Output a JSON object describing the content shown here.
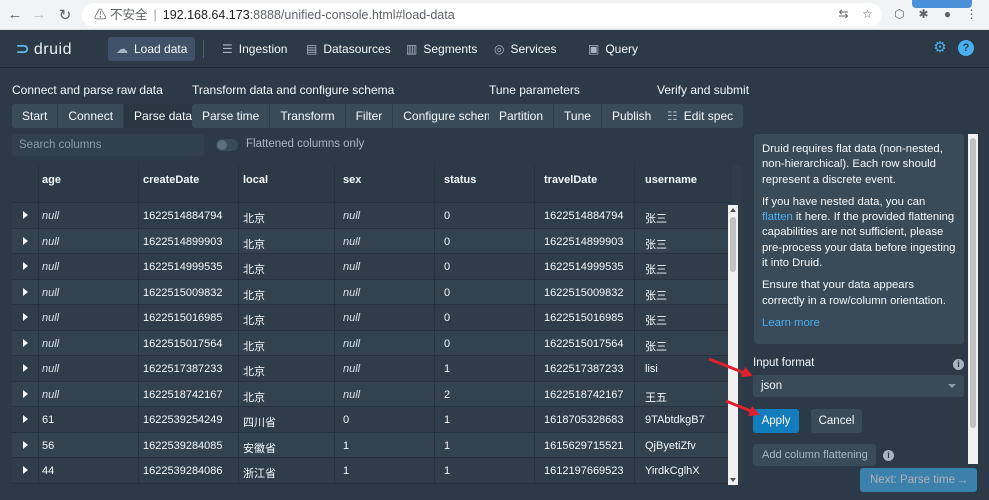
{
  "browser": {
    "back_icon": "arrow-left-icon",
    "forward_icon": "arrow-right-icon",
    "reload_icon": "reload-icon",
    "security_label": "不安全",
    "url_host": "192.168.64.173",
    "url_rest": ":8888/unified-console.html#load-data"
  },
  "nav": {
    "logo": "druid",
    "items": [
      {
        "label": "Load data",
        "icon": "cloud-upload-icon"
      },
      {
        "label": "Ingestion",
        "icon": "gantt-chart-icon"
      },
      {
        "label": "Datasources",
        "icon": "multi-select-icon"
      },
      {
        "label": "Segments",
        "icon": "stacked-chart-icon"
      },
      {
        "label": "Services",
        "icon": "database-icon"
      },
      {
        "label": "Query",
        "icon": "application-icon"
      }
    ]
  },
  "steps": {
    "groups": [
      {
        "title": "Connect and parse raw data",
        "buttons": [
          "Start",
          "Connect",
          "Parse data"
        ]
      },
      {
        "title": "Transform data and configure schema",
        "buttons": [
          "Parse time",
          "Transform",
          "Filter",
          "Configure schema"
        ]
      },
      {
        "title": "Tune parameters",
        "buttons": [
          "Partition",
          "Tune",
          "Publish"
        ]
      },
      {
        "title": "Verify and submit",
        "buttons": [
          "Edit spec"
        ]
      }
    ],
    "active": "Parse data"
  },
  "search": {
    "placeholder": "Search columns"
  },
  "flatten_toggle": {
    "label": "Flattened columns only",
    "on": false
  },
  "table": {
    "columns": [
      "age",
      "createDate",
      "local",
      "sex",
      "status",
      "travelDate",
      "username"
    ],
    "rows": [
      [
        "null",
        "1622514884794",
        "北京",
        "null",
        "0",
        "1622514884794",
        "张三"
      ],
      [
        "null",
        "1622514899903",
        "北京",
        "null",
        "0",
        "1622514899903",
        "张三"
      ],
      [
        "null",
        "1622514999535",
        "北京",
        "null",
        "0",
        "1622514999535",
        "张三"
      ],
      [
        "null",
        "1622515009832",
        "北京",
        "null",
        "0",
        "1622515009832",
        "张三"
      ],
      [
        "null",
        "1622515016985",
        "北京",
        "null",
        "0",
        "1622515016985",
        "张三"
      ],
      [
        "null",
        "1622515017564",
        "北京",
        "null",
        "0",
        "1622515017564",
        "张三"
      ],
      [
        "null",
        "1622517387233",
        "北京",
        "null",
        "1",
        "1622517387233",
        "lisi"
      ],
      [
        "null",
        "1622518742167",
        "北京",
        "null",
        "2",
        "1622518742167",
        "王五"
      ],
      [
        "61",
        "1622539254249",
        "四川省",
        "0",
        "1",
        "1618705328683",
        "9TAbtdkgB7"
      ],
      [
        "56",
        "1622539284085",
        "安徽省",
        "1",
        "1",
        "1615629715521",
        "QjByetiZfv"
      ],
      [
        "44",
        "1622539284086",
        "浙江省",
        "1",
        "1",
        "1612197669523",
        "YirdkCglhX"
      ]
    ]
  },
  "panel": {
    "para1": "Druid requires flat data (non-nested, non-hierarchical). Each row should represent a discrete event.",
    "para2_pre": "If you have nested data, you can ",
    "para2_link": "flatten",
    "para2_post": " it here. If the provided flattening capabilities are not sufficient, please pre-process your data before ingesting it into Druid.",
    "para3": "Ensure that your data appears correctly in a row/column orientation.",
    "learn_more": "Learn more",
    "input_format_label": "Input format",
    "input_format_value": "json",
    "apply": "Apply",
    "cancel": "Cancel",
    "add_flattening": "Add column flattening",
    "next": "Next: Parse time"
  },
  "colors": {
    "background": "#2c3a47",
    "accent": "#48aff0",
    "primary_button": "#137cbd",
    "annotation": "#e0202c"
  }
}
